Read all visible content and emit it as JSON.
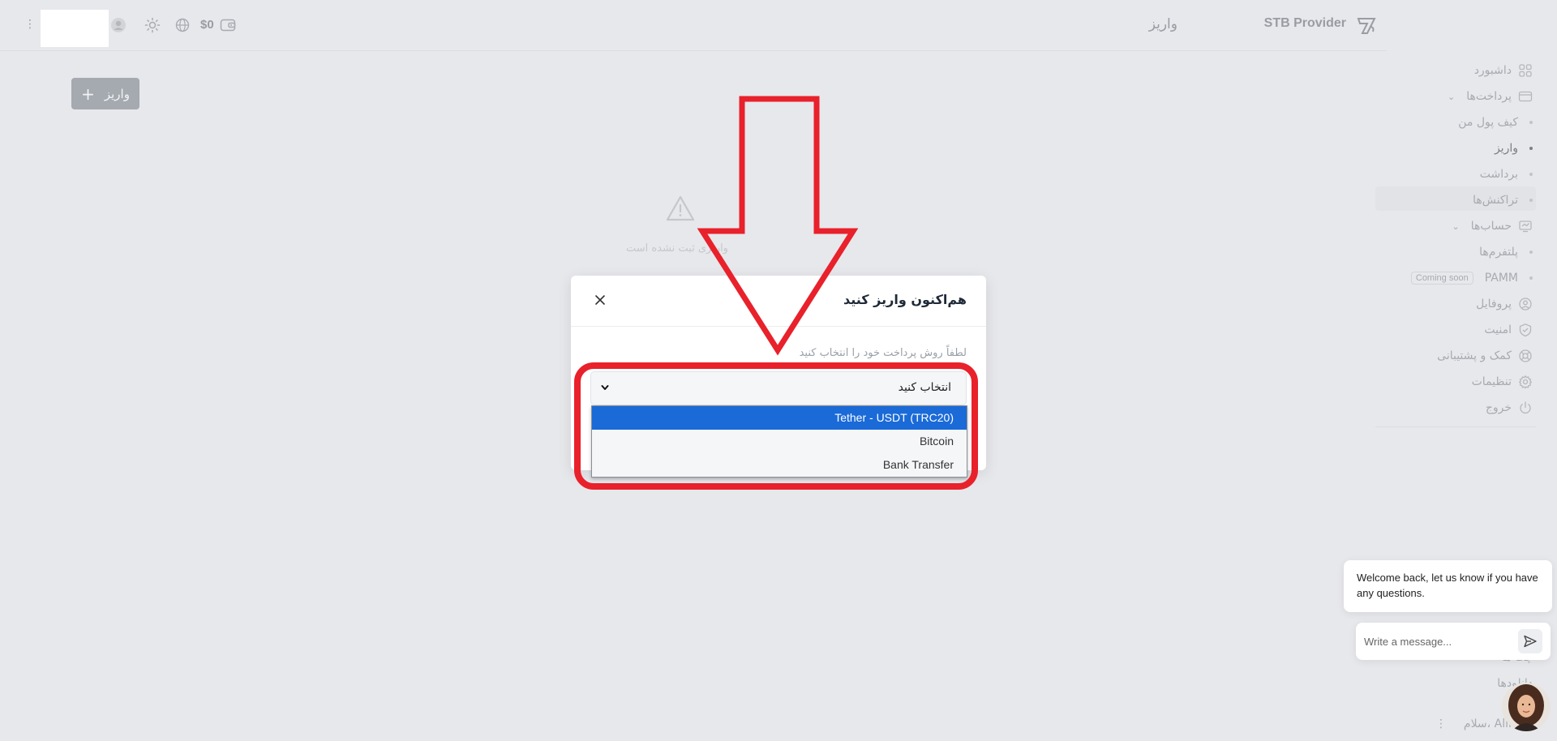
{
  "brand": {
    "name": "STB Provider",
    "logo_icon": "stb-logo-icon"
  },
  "header": {
    "title": "واریز",
    "balance": "$0"
  },
  "sidebar": {
    "dashboard": "داشبورد",
    "payments": "پرداخت‌ها",
    "payments_sub": [
      "کیف پول من",
      "واریز",
      "برداشت",
      "تراکنش‌ها"
    ],
    "accounts": "حساب‌ها",
    "accounts_sub": [
      "پلتفرم‌ها",
      "PAMM"
    ],
    "coming_soon": "Coming soon",
    "profile": "پروفایل",
    "security": "امنیت",
    "help": "کمک و پشتیبانی",
    "settings": "تنظیمات",
    "logout": "خروج",
    "bottom_items": [
      "چت ها",
      "دانلودها"
    ],
    "greeting": "سلام، Alireza"
  },
  "main": {
    "deposit_button": "واریز",
    "empty_text": "واریزی ثبت نشده است"
  },
  "modal": {
    "title": "هم‌اکنون واریز کنید",
    "label": "لطفاً روش پرداخت خود را انتخاب کنید",
    "select_value": "انتخاب کنید",
    "options": [
      "Tether - USDT (TRC20)",
      "Bitcoin",
      "Bank Transfer"
    ],
    "selected_option": "Tether - USDT (TRC20)"
  },
  "chat": {
    "welcome": "Welcome back, let us know if you have any questions.",
    "placeholder": "Write a message..."
  },
  "colors": {
    "annotation": "#e8212b",
    "selected": "#1a6ad8",
    "background": "#e7e8ec"
  }
}
